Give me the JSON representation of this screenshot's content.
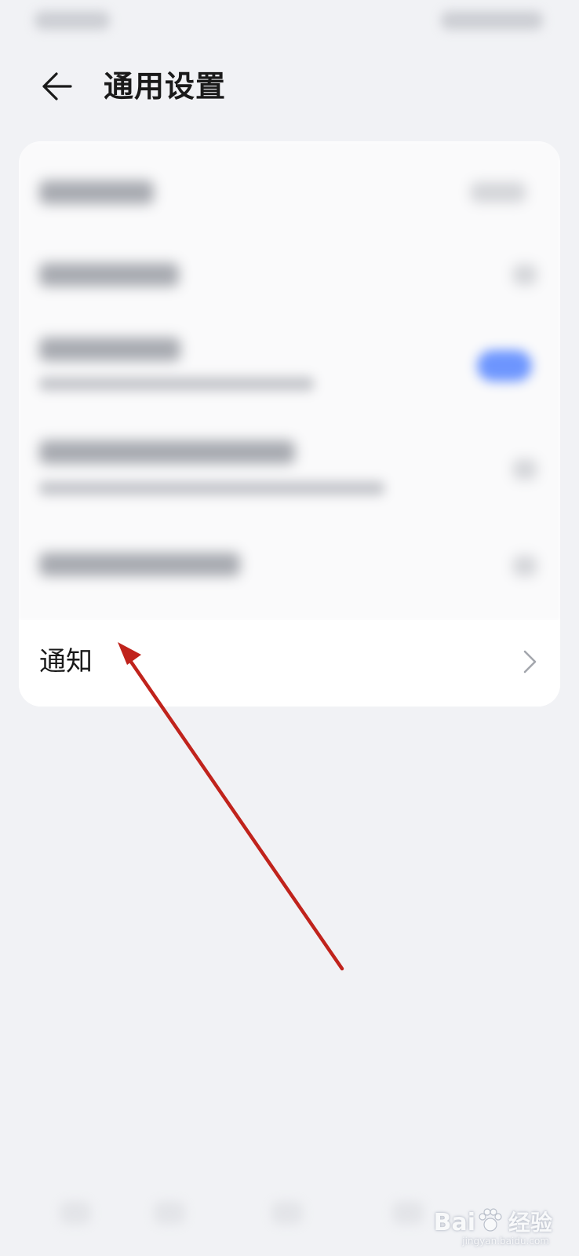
{
  "header": {
    "title": "通用设置",
    "back_icon": "arrow-left-icon"
  },
  "settings_list": {
    "notification_label": "通知",
    "notification_icon": "chevron-right-icon"
  },
  "annotation": {
    "arrow_color": "#c0231c"
  },
  "watermark": {
    "brand": "Bai",
    "brand_suffix": "经验",
    "url": "jingyan.baidu.com"
  },
  "colors": {
    "background": "#f1f2f5",
    "card": "#ffffff",
    "toggle_accent": "#5e8bff"
  }
}
